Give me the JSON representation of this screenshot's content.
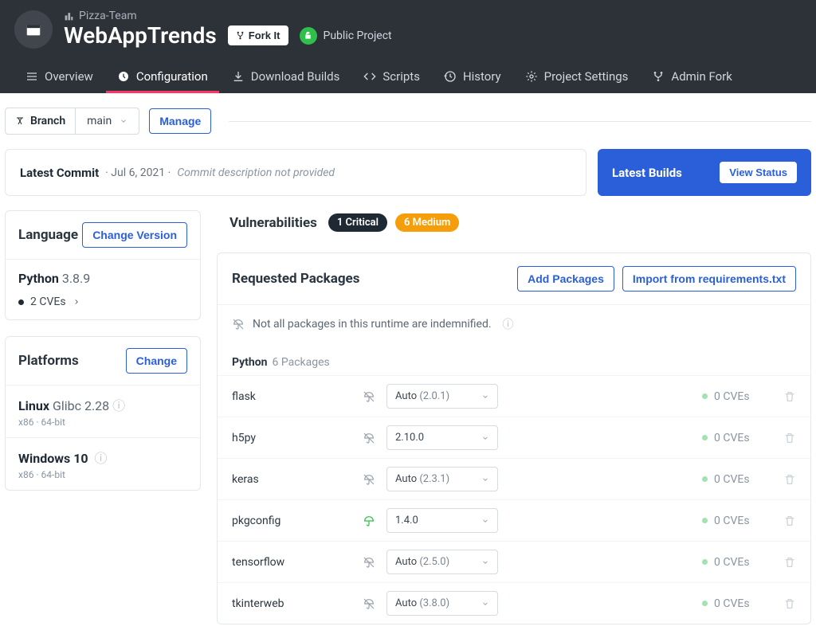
{
  "header": {
    "team": "Pizza-Team",
    "project": "WebAppTrends",
    "fork_label": "Fork It",
    "public_label": "Public Project"
  },
  "tabs": [
    {
      "label": "Overview"
    },
    {
      "label": "Configuration"
    },
    {
      "label": "Download Builds"
    },
    {
      "label": "Scripts"
    },
    {
      "label": "History"
    },
    {
      "label": "Project Settings"
    },
    {
      "label": "Admin Fork"
    }
  ],
  "branch": {
    "label": "Branch",
    "value": "main",
    "manage": "Manage"
  },
  "commit": {
    "label": "Latest Commit",
    "date": "Jul 6, 2021",
    "desc": "Commit description not provided"
  },
  "builds": {
    "title": "Latest Builds",
    "button": "View Status"
  },
  "language": {
    "title": "Language",
    "change": "Change Version",
    "name": "Python",
    "version": "3.8.9",
    "cves": "2 CVEs"
  },
  "platforms": {
    "title": "Platforms",
    "change": "Change",
    "items": [
      {
        "name": "Linux",
        "ver": "Glibc 2.28",
        "sub": "x86 · 64-bit"
      },
      {
        "name": "Windows 10",
        "ver": "",
        "sub": "x86 · 64-bit"
      }
    ]
  },
  "vulnerabilities": {
    "title": "Vulnerabilities",
    "critical": "1  Critical",
    "medium": "6  Medium"
  },
  "packages": {
    "title": "Requested Packages",
    "add": "Add Packages",
    "import": "Import from requirements.txt",
    "indemnify": "Not all packages in this runtime are indemnified.",
    "section_lang": "Python",
    "section_count": "6 Packages",
    "rows": [
      {
        "name": "flask",
        "auto": "Auto",
        "ver": "(2.0.1)",
        "cves": "0 CVEs",
        "covered": false
      },
      {
        "name": "h5py",
        "auto": "",
        "ver": "2.10.0",
        "cves": "0 CVEs",
        "covered": false
      },
      {
        "name": "keras",
        "auto": "Auto",
        "ver": "(2.3.1)",
        "cves": "0 CVEs",
        "covered": false
      },
      {
        "name": "pkgconfig",
        "auto": "",
        "ver": "1.4.0",
        "cves": "0 CVEs",
        "covered": true
      },
      {
        "name": "tensorflow",
        "auto": "Auto",
        "ver": "(2.5.0)",
        "cves": "0 CVEs",
        "covered": false
      },
      {
        "name": "tkinterweb",
        "auto": "Auto",
        "ver": "(3.8.0)",
        "cves": "0 CVEs",
        "covered": false
      }
    ]
  }
}
